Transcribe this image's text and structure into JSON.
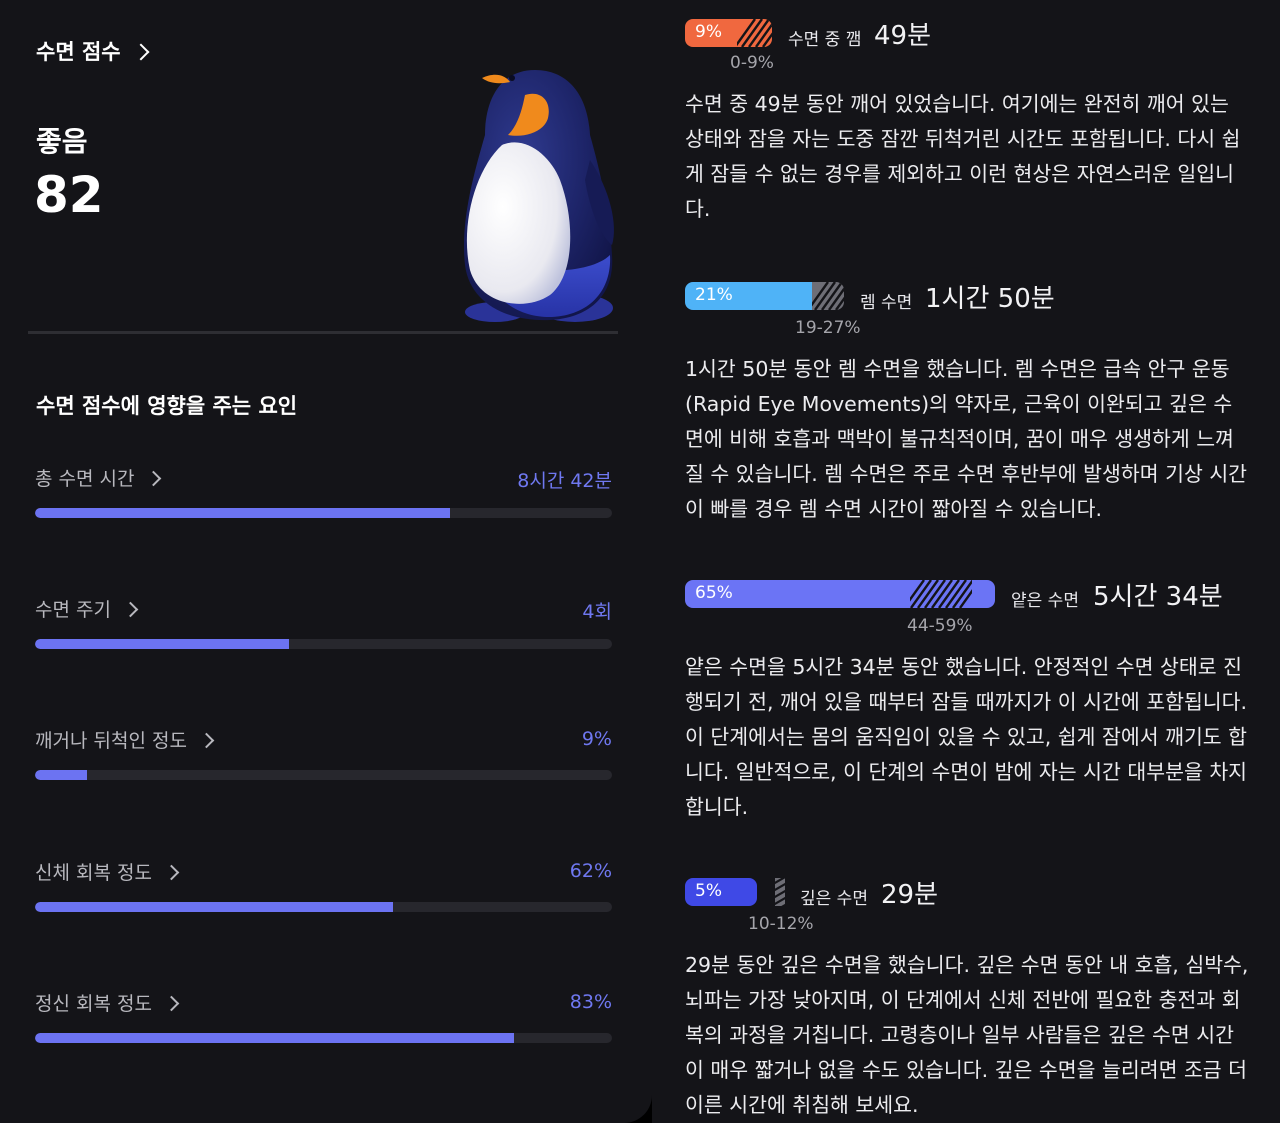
{
  "score_card": {
    "title": "수면 점수",
    "rating": "좋음",
    "score": "82"
  },
  "factors": {
    "title": "수면 점수에 영향을 주는 요인",
    "items": [
      {
        "label": "총 수면 시간",
        "value": "8시간 42분",
        "level": 0.72
      },
      {
        "label": "수면 주기",
        "value": "4회",
        "level": 0.44
      },
      {
        "label": "깨거나 뒤척인 정도",
        "value": "9%",
        "level": 0.09
      },
      {
        "label": "신체 회복 정도",
        "value": "62%",
        "level": 0.62
      },
      {
        "label": "정신 회복 정도",
        "value": "83%",
        "level": 0.83
      }
    ]
  },
  "stages": [
    {
      "percent": "9%",
      "name": "수면 중 깸",
      "duration": "49분",
      "range": "0-9%",
      "color": "#f0683f",
      "description": "수면 중 49분 동안 깨어 있었습니다. 여기에는 완전히 깨어 있는 상태와 잠을 자는 도중 잠깐 뒤척거린 시간도 포함됩니다. 다시 쉽게 잠들 수 없는 경우를 제외하고 이런 현상은 자연스러운 일입니다."
    },
    {
      "percent": "21%",
      "name": "렘 수면",
      "duration": "1시간 50분",
      "range": "19-27%",
      "color": "#4fb3f7",
      "description": "1시간 50분 동안 렘 수면을 했습니다. 렘 수면은 급속 안구 운동(Rapid Eye Movements)의 약자로, 근육이 이완되고 깊은 수면에 비해 호흡과 맥박이 불규칙적이며, 꿈이 매우 생생하게 느껴질 수 있습니다. 렘 수면은 주로 수면 후반부에 발생하며 기상 시간이 빠를 경우 렘 수면 시간이 짧아질 수 있습니다."
    },
    {
      "percent": "65%",
      "name": "얕은 수면",
      "duration": "5시간 34분",
      "range": "44-59%",
      "color": "#6b74f5",
      "description": "얕은 수면을 5시간 34분 동안 했습니다. 안정적인 수면 상태로 진행되기 전, 깨어 있을 때부터 잠들 때까지가 이 시간에 포함됩니다. 이 단계에서는 몸의 움직임이 있을 수 있고, 쉽게 잠에서 깨기도 합니다. 일반적으로, 이 단계의 수면이 밤에 자는 시간 대부분을 차지합니다."
    },
    {
      "percent": "5%",
      "name": "깊은 수면",
      "duration": "29분",
      "range": "10-12%",
      "color": "#3f49e6",
      "description": "29분 동안 깊은 수면을 했습니다. 깊은 수면 동안 내 호흡, 심박수, 뇌파는 가장 낮아지며, 이 단계에서 신체 전반에 필요한 충전과 회복의 과정을 거칩니다. 고령층이나 일부 사람들은 깊은 수면 시간이 매우 짧거나 없을 수도 있습니다. 깊은 수면을 늘리려면 조금 더 이른 시간에 취침해 보세요."
    }
  ]
}
